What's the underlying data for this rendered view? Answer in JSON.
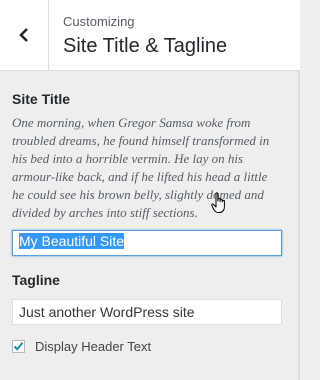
{
  "header": {
    "subtitle": "Customizing",
    "title": "Site Title & Tagline"
  },
  "site_title": {
    "label": "Site Title",
    "description": "One morning, when Gregor Samsa woke from troubled dreams, he found himself transformed in his bed into a horrible vermin. He lay on his armour-like back, and if he lifted his head a little he could see his brown belly, slightly domed and divided by arches into stiff sections.",
    "value": "My Beautiful Site"
  },
  "tagline": {
    "label": "Tagline",
    "value": "Just another WordPress site"
  },
  "display_header_text": {
    "label": "Display Header Text",
    "checked": true
  },
  "icons": {
    "back": "chevron-left-icon",
    "checkbox": "checkmark-icon",
    "cursor": "hand-pointer-icon"
  },
  "colors": {
    "focus_border": "#5b9dd9",
    "selection": "#3399ff",
    "checkmark": "#1e8cbe"
  }
}
